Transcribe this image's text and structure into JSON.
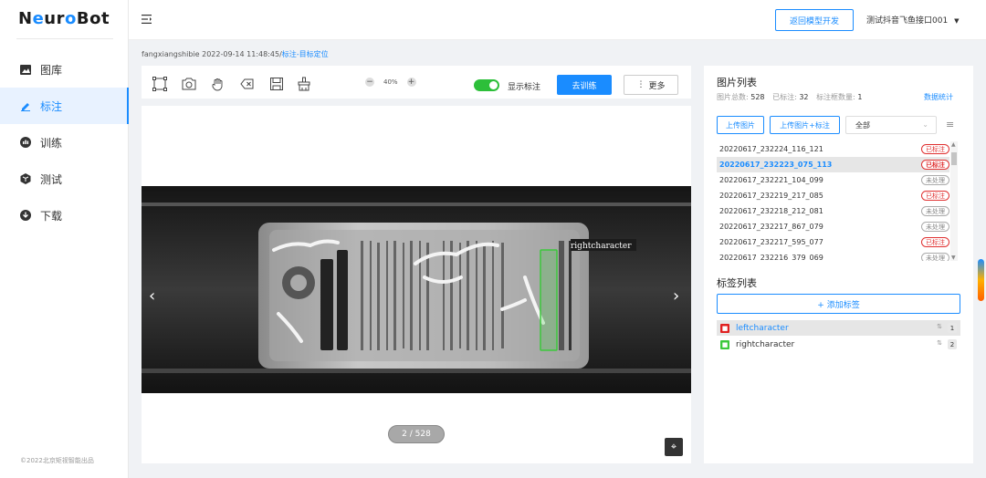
{
  "app": {
    "logo_pre": "N",
    "logo_o1": "e",
    "logo_mid": "ur",
    "logo_o2": "o",
    "logo_post": "Bot"
  },
  "sidebar": {
    "items": [
      {
        "label": "图库",
        "icon": "image-icon"
      },
      {
        "label": "标注",
        "icon": "pen-icon"
      },
      {
        "label": "训练",
        "icon": "train-icon"
      },
      {
        "label": "测试",
        "icon": "cube-icon"
      },
      {
        "label": "下载",
        "icon": "download-icon"
      }
    ],
    "active_index": 1,
    "copyright": "©2022北京矩视智能出品"
  },
  "header": {
    "back_button": "返回模型开发",
    "user": "测试抖音飞鱼接口001"
  },
  "breadcrumb": {
    "prefix": "fangxiangshibie 2022-09-14 11:48:45/",
    "link": "标注-目标定位"
  },
  "toolbar": {
    "zoom": "40%",
    "show_labels": "显示标注",
    "train_button": "去训练",
    "more_button": "更多"
  },
  "viewer": {
    "annotation_label": "rightcharacter",
    "page_indicator": "2 / 528"
  },
  "image_list": {
    "title": "图片列表",
    "total_label": "图片总数:",
    "total": "528",
    "annotated_label": "已标注:",
    "annotated": "32",
    "boxes_label": "标注框数量:",
    "boxes": "1",
    "stats_link": "数据统计",
    "upload_button": "上传图片",
    "upload_annotated_button": "上传图片+标注",
    "filter_value": "全部",
    "files": [
      {
        "name": "20220617_232224_116_121",
        "status": "已标注",
        "done": true
      },
      {
        "name": "20220617_232223_075_113",
        "status": "已标注",
        "done": true
      },
      {
        "name": "20220617_232221_104_099",
        "status": "未处理",
        "done": false
      },
      {
        "name": "20220617_232219_217_085",
        "status": "已标注",
        "done": true
      },
      {
        "name": "20220617_232218_212_081",
        "status": "未处理",
        "done": false
      },
      {
        "name": "20220617_232217_867_079",
        "status": "未处理",
        "done": false
      },
      {
        "name": "20220617_232217_595_077",
        "status": "已标注",
        "done": true
      },
      {
        "name": "20220617_232216_379_069",
        "status": "未处理",
        "done": false
      }
    ],
    "selected_index": 1
  },
  "label_list": {
    "title": "标签列表",
    "add_button": "+ 添加标签",
    "tags": [
      {
        "name": "leftcharacter",
        "count": "1",
        "color": "#e02020"
      },
      {
        "name": "rightcharacter",
        "count": "2",
        "color": "#3cc83c"
      }
    ]
  },
  "colors": {
    "accent": "#1a8cff",
    "toggle_on": "#2dbf3a",
    "done": "#e03030"
  }
}
